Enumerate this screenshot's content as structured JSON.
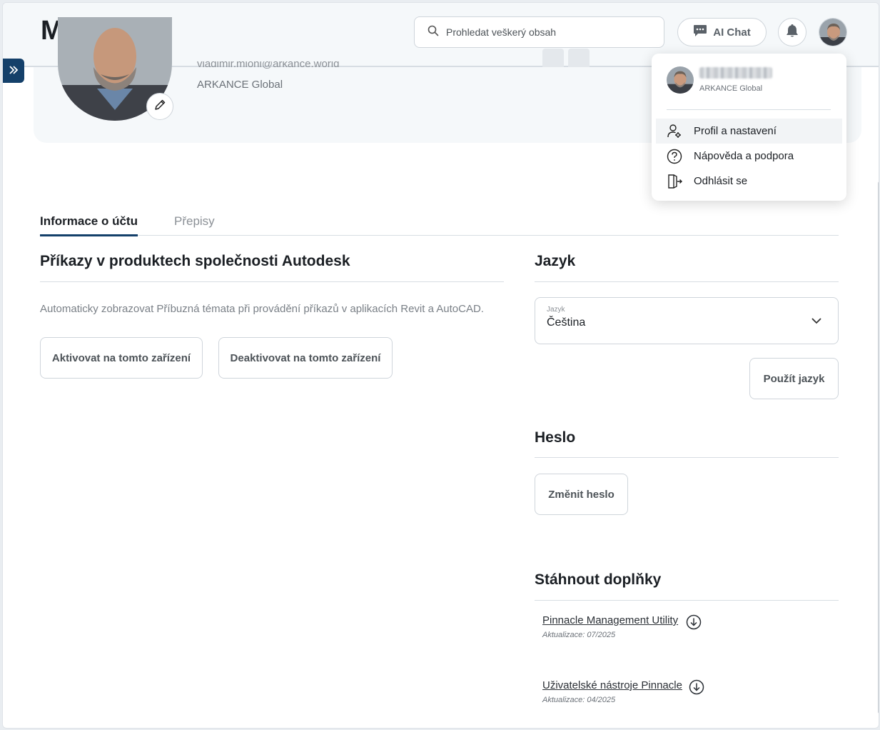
{
  "header": {
    "title": "Můj účet",
    "search_placeholder": "Prohledat veškerý obsah",
    "ai_chat_label": "AI Chat"
  },
  "profile": {
    "email_partial": "vladimir.mloni@arkance.world",
    "company": "ARKANCE Global"
  },
  "tabs": [
    {
      "label": "Informace o účtu",
      "active": true
    },
    {
      "label": "Přepisy",
      "active": false
    }
  ],
  "autodesk": {
    "title": "Příkazy v produktech společnosti Autodesk",
    "description": "Automaticky zobrazovat Příbuzná témata při provádění příkazů v aplikacích Revit a AutoCAD.",
    "activate_label": "Aktivovat na tomto zařízení",
    "deactivate_label": "Deaktivovat na tomto zařízení"
  },
  "language": {
    "title": "Jazyk",
    "field_label": "Jazyk",
    "selected": "Čeština",
    "apply_label": "Použít jazyk"
  },
  "password": {
    "title": "Heslo",
    "change_label": "Změnit heslo"
  },
  "downloads": {
    "title": "Stáhnout doplňky",
    "items": [
      {
        "name": "Pinnacle Management Utility",
        "updated": "Aktualizace: 07/2025"
      },
      {
        "name": "Uživatelské nástroje Pinnacle",
        "updated": "Aktualizace: 04/2025"
      }
    ]
  },
  "user_menu": {
    "company": "ARKANCE Global",
    "items": [
      {
        "label": "Profil a nastavení",
        "icon": "user-gear-icon"
      },
      {
        "label": "Nápověda a podpora",
        "icon": "help-circle-icon"
      },
      {
        "label": "Odhlásit se",
        "icon": "logout-icon"
      }
    ]
  },
  "colors": {
    "accent": "#14406a",
    "header_bg": "#f5f8fa"
  }
}
